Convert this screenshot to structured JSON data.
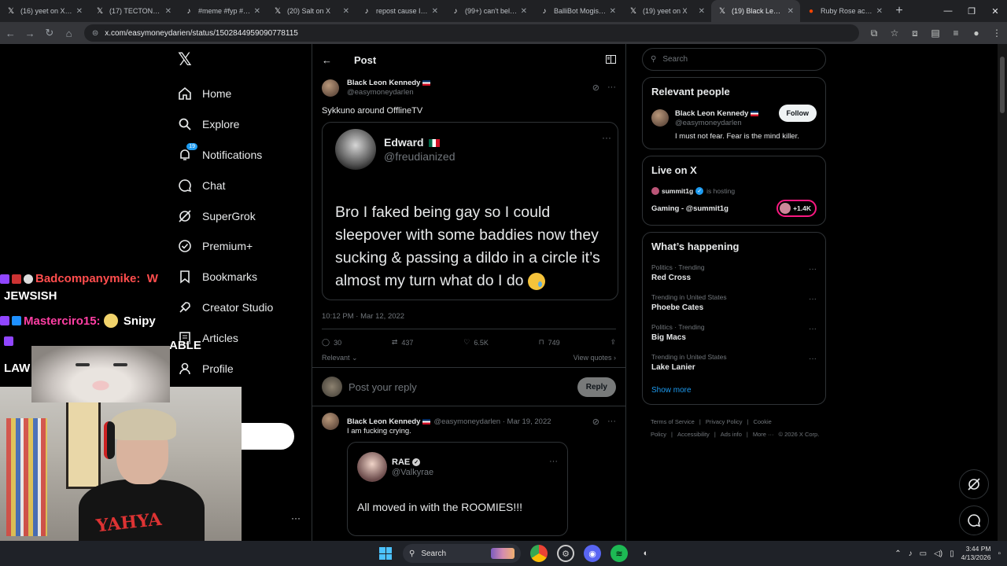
{
  "browser": {
    "tabs": [
      {
        "title": "(16) yeet on X: \"V",
        "icon": "x-logo-icon",
        "active": false
      },
      {
        "title": "(17) TECTONE us",
        "icon": "x-logo-icon",
        "active": false
      },
      {
        "title": "#meme #fyp #vira",
        "icon": "tiktok-icon",
        "active": false
      },
      {
        "title": "(20) Salt on X",
        "icon": "x-logo-icon",
        "active": false
      },
      {
        "title": "repost cause I wo",
        "icon": "tiktok-icon",
        "active": false
      },
      {
        "title": "(99+) can't believe",
        "icon": "tiktok-icon",
        "active": false
      },
      {
        "title": "BalliBot Mogis: Th",
        "icon": "tiktok-icon",
        "active": false
      },
      {
        "title": "(19) yeet on X",
        "icon": "x-logo-icon",
        "active": false
      },
      {
        "title": "(19) Black Leon K",
        "icon": "x-logo-icon",
        "active": true
      },
      {
        "title": "Ruby Rose accuse",
        "icon": "reddit-icon",
        "active": false
      }
    ],
    "new_tab": "+",
    "url": "x.com/easymoneydarien/status/1502844959090778115"
  },
  "sidebar": {
    "logo": "𝕏",
    "items": [
      {
        "label": "Home",
        "icon": "home-icon"
      },
      {
        "label": "Explore",
        "icon": "search-icon"
      },
      {
        "label": "Notifications",
        "icon": "bell-icon",
        "badge": "19"
      },
      {
        "label": "Chat",
        "icon": "chat-icon"
      },
      {
        "label": "SuperGrok",
        "icon": "grok-icon"
      },
      {
        "label": "Premium+",
        "icon": "premium-icon"
      },
      {
        "label": "Bookmarks",
        "icon": "bookmark-icon"
      },
      {
        "label": "Creator Studio",
        "icon": "rocket-icon"
      },
      {
        "label": "Articles",
        "icon": "article-icon"
      },
      {
        "label": "Profile",
        "icon": "person-icon"
      }
    ]
  },
  "post": {
    "header_title": "Post",
    "author_name": "Black Leon Kennedy",
    "author_handle": "@easymoneydarlen",
    "text": "Sykkuno around OfflineTV",
    "quote": {
      "name": "Edward",
      "handle": "@freudianized",
      "text": "Bro I faked being gay so I could sleepover with some baddies now they sucking & passing a dildo in a circle it’s almost my turn what do I do"
    },
    "timestamp": "10:12 PM · Mar 12, 2022",
    "stats": {
      "replies": "30",
      "reposts": "437",
      "likes": "6.5K",
      "bookmarks": "749"
    },
    "sort_label": "Relevant",
    "view_quotes": "View quotes",
    "reply_placeholder": "Post your reply",
    "reply_button": "Reply"
  },
  "reply": {
    "author_name": "Black Leon Kennedy",
    "meta": "@easymoneydarlen · Mar 19, 2022",
    "text": "I am fucking crying.",
    "quote": {
      "name": "RAE",
      "handle": "@Valkyrae",
      "text": "All moved in with the ROOMIES!!!"
    }
  },
  "right": {
    "search_placeholder": "Search",
    "relevant": {
      "title": "Relevant people",
      "name": "Black Leon Kennedy",
      "handle": "@easymoneydarlen",
      "bio": "I must not fear. Fear is the mind killer.",
      "follow": "Follow"
    },
    "live": {
      "title": "Live on X",
      "host": "summit1g",
      "hosting": "is hosting",
      "stream_title": "Gaming - @summit1g",
      "count": "+1.4K"
    },
    "happening": {
      "title": "What’s happening",
      "trends": [
        {
          "context": "Politics · Trending",
          "topic": "Red Cross"
        },
        {
          "context": "Trending in United States",
          "topic": "Phoebe Cates"
        },
        {
          "context": "Politics · Trending",
          "topic": "Big Macs"
        },
        {
          "context": "Trending in United States",
          "topic": "Lake Lanier"
        }
      ],
      "show_more": "Show more"
    },
    "footer": [
      "Terms of Service",
      "|",
      "Privacy Policy",
      "|",
      "Cookie Policy",
      "|",
      "Accessibility",
      "|",
      "Ads info",
      "|",
      "More ···",
      "© 2026 X Corp."
    ]
  },
  "overlay": {
    "chat_lines": [
      {
        "user": "Badcompanymike:",
        "msg": "W",
        "color": "#ff4d4d"
      },
      {
        "msg": "JEWSISH"
      },
      {
        "user": "Masterciro15:",
        "msg": "Snipy",
        "color": "#ff3fa4"
      },
      {
        "msg": "ABLE"
      },
      {
        "msg": "LAW"
      }
    ],
    "shirt_text": "YAHYA"
  },
  "taskbar": {
    "search": "Search",
    "time": "3:44 PM",
    "date": "4/13/2026"
  }
}
